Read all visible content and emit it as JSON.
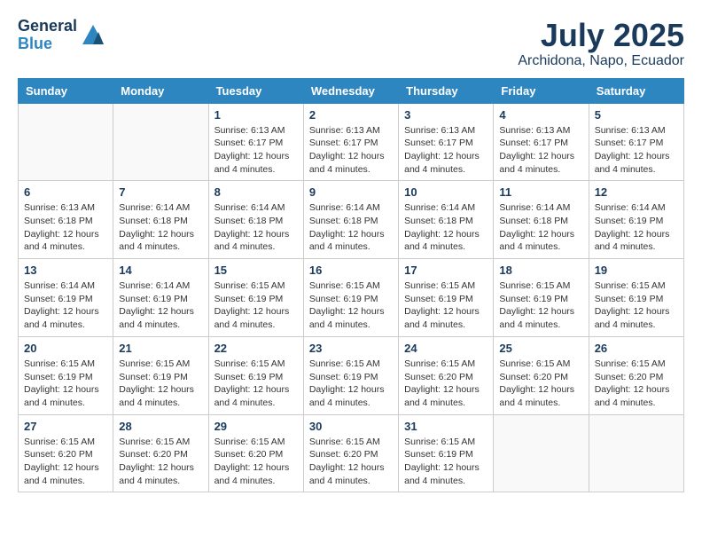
{
  "header": {
    "logo_general": "General",
    "logo_blue": "Blue",
    "title": "July 2025",
    "subtitle": "Archidona, Napo, Ecuador"
  },
  "weekdays": [
    "Sunday",
    "Monday",
    "Tuesday",
    "Wednesday",
    "Thursday",
    "Friday",
    "Saturday"
  ],
  "weeks": [
    [
      {
        "day": "",
        "info": ""
      },
      {
        "day": "",
        "info": ""
      },
      {
        "day": "1",
        "info": "Sunrise: 6:13 AM\nSunset: 6:17 PM\nDaylight: 12 hours and 4 minutes."
      },
      {
        "day": "2",
        "info": "Sunrise: 6:13 AM\nSunset: 6:17 PM\nDaylight: 12 hours and 4 minutes."
      },
      {
        "day": "3",
        "info": "Sunrise: 6:13 AM\nSunset: 6:17 PM\nDaylight: 12 hours and 4 minutes."
      },
      {
        "day": "4",
        "info": "Sunrise: 6:13 AM\nSunset: 6:17 PM\nDaylight: 12 hours and 4 minutes."
      },
      {
        "day": "5",
        "info": "Sunrise: 6:13 AM\nSunset: 6:17 PM\nDaylight: 12 hours and 4 minutes."
      }
    ],
    [
      {
        "day": "6",
        "info": "Sunrise: 6:13 AM\nSunset: 6:18 PM\nDaylight: 12 hours and 4 minutes."
      },
      {
        "day": "7",
        "info": "Sunrise: 6:14 AM\nSunset: 6:18 PM\nDaylight: 12 hours and 4 minutes."
      },
      {
        "day": "8",
        "info": "Sunrise: 6:14 AM\nSunset: 6:18 PM\nDaylight: 12 hours and 4 minutes."
      },
      {
        "day": "9",
        "info": "Sunrise: 6:14 AM\nSunset: 6:18 PM\nDaylight: 12 hours and 4 minutes."
      },
      {
        "day": "10",
        "info": "Sunrise: 6:14 AM\nSunset: 6:18 PM\nDaylight: 12 hours and 4 minutes."
      },
      {
        "day": "11",
        "info": "Sunrise: 6:14 AM\nSunset: 6:18 PM\nDaylight: 12 hours and 4 minutes."
      },
      {
        "day": "12",
        "info": "Sunrise: 6:14 AM\nSunset: 6:19 PM\nDaylight: 12 hours and 4 minutes."
      }
    ],
    [
      {
        "day": "13",
        "info": "Sunrise: 6:14 AM\nSunset: 6:19 PM\nDaylight: 12 hours and 4 minutes."
      },
      {
        "day": "14",
        "info": "Sunrise: 6:14 AM\nSunset: 6:19 PM\nDaylight: 12 hours and 4 minutes."
      },
      {
        "day": "15",
        "info": "Sunrise: 6:15 AM\nSunset: 6:19 PM\nDaylight: 12 hours and 4 minutes."
      },
      {
        "day": "16",
        "info": "Sunrise: 6:15 AM\nSunset: 6:19 PM\nDaylight: 12 hours and 4 minutes."
      },
      {
        "day": "17",
        "info": "Sunrise: 6:15 AM\nSunset: 6:19 PM\nDaylight: 12 hours and 4 minutes."
      },
      {
        "day": "18",
        "info": "Sunrise: 6:15 AM\nSunset: 6:19 PM\nDaylight: 12 hours and 4 minutes."
      },
      {
        "day": "19",
        "info": "Sunrise: 6:15 AM\nSunset: 6:19 PM\nDaylight: 12 hours and 4 minutes."
      }
    ],
    [
      {
        "day": "20",
        "info": "Sunrise: 6:15 AM\nSunset: 6:19 PM\nDaylight: 12 hours and 4 minutes."
      },
      {
        "day": "21",
        "info": "Sunrise: 6:15 AM\nSunset: 6:19 PM\nDaylight: 12 hours and 4 minutes."
      },
      {
        "day": "22",
        "info": "Sunrise: 6:15 AM\nSunset: 6:19 PM\nDaylight: 12 hours and 4 minutes."
      },
      {
        "day": "23",
        "info": "Sunrise: 6:15 AM\nSunset: 6:19 PM\nDaylight: 12 hours and 4 minutes."
      },
      {
        "day": "24",
        "info": "Sunrise: 6:15 AM\nSunset: 6:20 PM\nDaylight: 12 hours and 4 minutes."
      },
      {
        "day": "25",
        "info": "Sunrise: 6:15 AM\nSunset: 6:20 PM\nDaylight: 12 hours and 4 minutes."
      },
      {
        "day": "26",
        "info": "Sunrise: 6:15 AM\nSunset: 6:20 PM\nDaylight: 12 hours and 4 minutes."
      }
    ],
    [
      {
        "day": "27",
        "info": "Sunrise: 6:15 AM\nSunset: 6:20 PM\nDaylight: 12 hours and 4 minutes."
      },
      {
        "day": "28",
        "info": "Sunrise: 6:15 AM\nSunset: 6:20 PM\nDaylight: 12 hours and 4 minutes."
      },
      {
        "day": "29",
        "info": "Sunrise: 6:15 AM\nSunset: 6:20 PM\nDaylight: 12 hours and 4 minutes."
      },
      {
        "day": "30",
        "info": "Sunrise: 6:15 AM\nSunset: 6:20 PM\nDaylight: 12 hours and 4 minutes."
      },
      {
        "day": "31",
        "info": "Sunrise: 6:15 AM\nSunset: 6:19 PM\nDaylight: 12 hours and 4 minutes."
      },
      {
        "day": "",
        "info": ""
      },
      {
        "day": "",
        "info": ""
      }
    ]
  ]
}
